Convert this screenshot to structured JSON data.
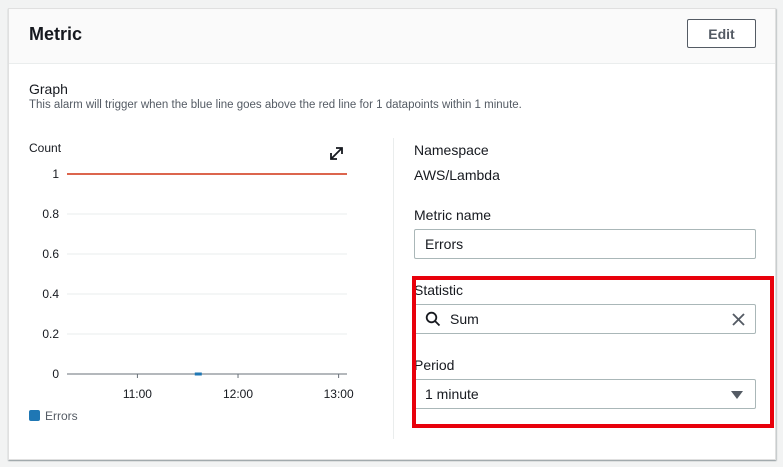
{
  "panel": {
    "title": "Metric",
    "edit_label": "Edit"
  },
  "graph": {
    "title": "Graph",
    "description": "This alarm will trigger when the blue line goes above the red line for 1 datapoints within 1 minute."
  },
  "chart_data": {
    "type": "line",
    "ylabel": "Count",
    "ylim": [
      0,
      1
    ],
    "y_ticks": [
      "1",
      "0.8",
      "0.6",
      "0.4",
      "0.2",
      "0"
    ],
    "x_ticks": [
      "11:00",
      "12:00",
      "13:00"
    ],
    "threshold": {
      "value": 1,
      "color": "#d13212"
    },
    "series": [
      {
        "name": "Errors",
        "color": "#1f77b4",
        "points": [
          {
            "x": "11:36",
            "y": 0
          }
        ]
      }
    ],
    "legend": "bottom-left",
    "grid": true
  },
  "details": {
    "namespace_label": "Namespace",
    "namespace_value": "AWS/Lambda",
    "metric_name_label": "Metric name",
    "metric_name_value": "Errors",
    "statistic_label": "Statistic",
    "statistic_value": "Sum",
    "period_label": "Period",
    "period_value": "1 minute"
  },
  "icons": {
    "expand": "expand-icon",
    "search": "search-icon",
    "clear": "close-icon",
    "dropdown": "caret-down-icon"
  },
  "colors": {
    "highlight": "#e8000b",
    "threshold": "#d13212",
    "series": "#1f77b4"
  }
}
